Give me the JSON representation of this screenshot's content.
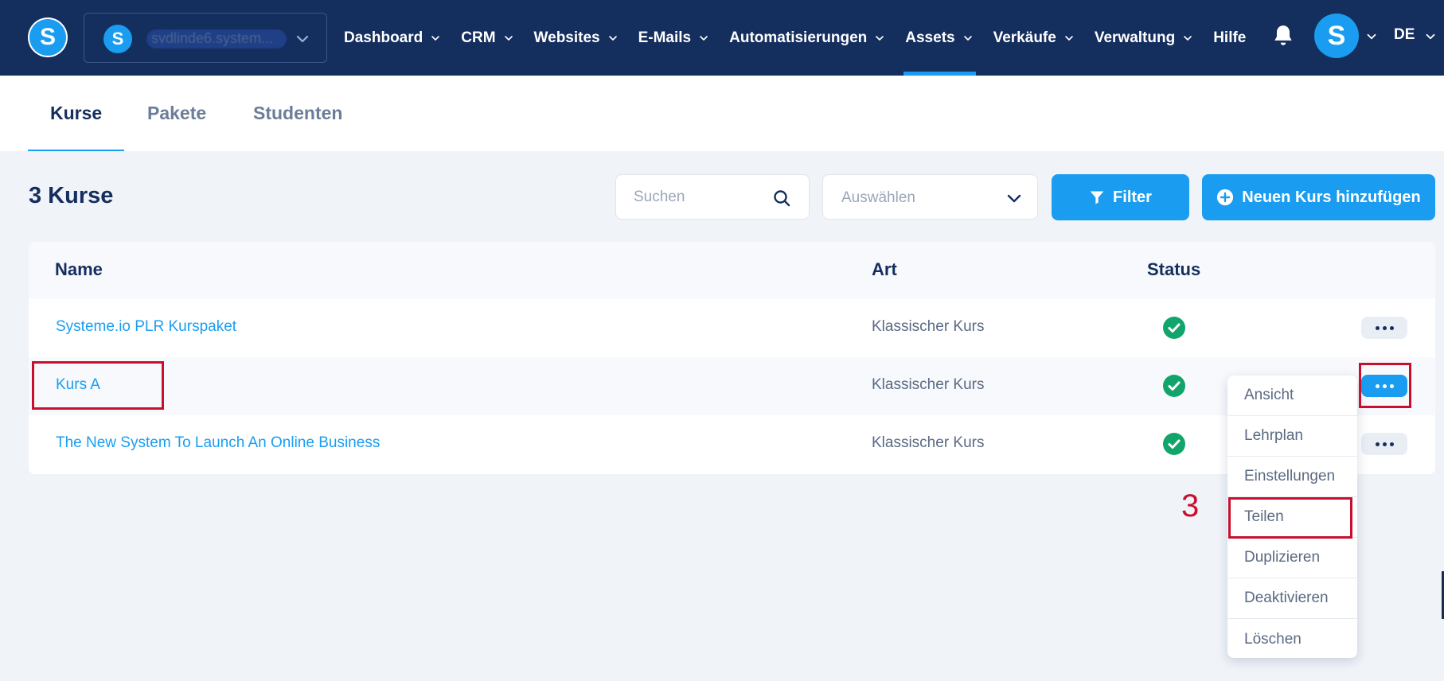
{
  "topbar": {
    "logo_letter": "S",
    "workspace": {
      "avatar_letter": "S",
      "name": "svdlinde6.system..."
    },
    "nav_items": [
      {
        "label": "Dashboard",
        "has_dropdown": true,
        "active": false
      },
      {
        "label": "CRM",
        "has_dropdown": true,
        "active": false
      },
      {
        "label": "Websites",
        "has_dropdown": true,
        "active": false
      },
      {
        "label": "E-Mails",
        "has_dropdown": true,
        "active": false
      },
      {
        "label": "Automatisierungen",
        "has_dropdown": true,
        "active": false
      },
      {
        "label": "Assets",
        "has_dropdown": true,
        "active": true
      },
      {
        "label": "Verkäufe",
        "has_dropdown": true,
        "active": false
      },
      {
        "label": "Verwaltung",
        "has_dropdown": true,
        "active": false
      },
      {
        "label": "Hilfe",
        "has_dropdown": false,
        "active": false
      }
    ],
    "user_avatar_letter": "S",
    "language": "DE"
  },
  "subtabs": [
    {
      "label": "Kurse",
      "active": true
    },
    {
      "label": "Pakete",
      "active": false
    },
    {
      "label": "Studenten",
      "active": false
    }
  ],
  "page": {
    "title": "3 Kurse",
    "search_placeholder": "Suchen",
    "select_placeholder": "Auswählen",
    "filter_label": "Filter",
    "add_label": "Neuen Kurs hinzufügen"
  },
  "table": {
    "columns": [
      "Name",
      "Art",
      "Status"
    ],
    "rows": [
      {
        "name": "Systeme.io PLR Kurspaket",
        "art": "Klassischer Kurs",
        "status": "active"
      },
      {
        "name": "Kurs A",
        "art": "Klassischer Kurs",
        "status": "active"
      },
      {
        "name": "The New System To Launch An Online Business",
        "art": "Klassischer Kurs",
        "status": "active"
      }
    ]
  },
  "menu": {
    "items": [
      "Ansicht",
      "Lehrplan",
      "Einstellungen",
      "Teilen",
      "Duplizieren",
      "Deaktivieren",
      "Löschen"
    ]
  },
  "annotation": {
    "step_number": "3",
    "color": "#c8102e"
  },
  "colors": {
    "nav_bg": "#142e5e",
    "accent": "#1a9df0",
    "status_green": "#12a56b"
  }
}
